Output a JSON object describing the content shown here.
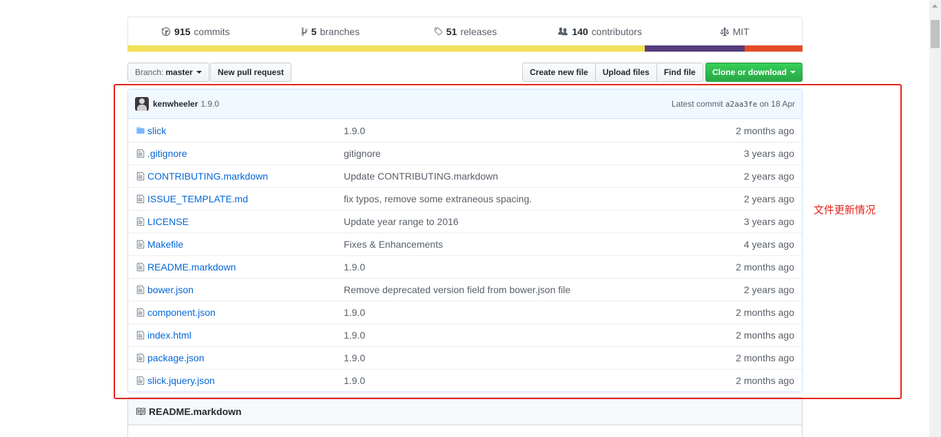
{
  "summary": {
    "commits_num": "915",
    "commits_label": "commits",
    "branches_num": "5",
    "branches_label": "branches",
    "releases_num": "51",
    "releases_label": "releases",
    "contributors_num": "140",
    "contributors_label": "contributors",
    "license": "MIT",
    "language_colors": [
      "#f1e05a",
      "#563d7c",
      "#e34c26"
    ],
    "language_shares": [
      0.766,
      0.148,
      0.086
    ]
  },
  "toolbar": {
    "branch_prefix": "Branch:",
    "branch_name": "master",
    "new_pull_request": "New pull request",
    "create_new_file": "Create new file",
    "upload_files": "Upload files",
    "find_file": "Find file",
    "clone_download": "Clone or download"
  },
  "commit": {
    "author": "kenwheeler",
    "message": "1.9.0",
    "latest_prefix": "Latest commit",
    "sha": "a2aa3fe",
    "date": "on 18 Apr"
  },
  "files": [
    {
      "type": "folder",
      "name": "slick",
      "message": "1.9.0",
      "age": "2 months ago"
    },
    {
      "type": "file",
      "name": ".gitignore",
      "message": "gitignore",
      "age": "3 years ago"
    },
    {
      "type": "file",
      "name": "CONTRIBUTING.markdown",
      "message": "Update CONTRIBUTING.markdown",
      "age": "2 years ago"
    },
    {
      "type": "file",
      "name": "ISSUE_TEMPLATE.md",
      "message": "fix typos, remove some extraneous spacing.",
      "age": "2 years ago"
    },
    {
      "type": "file",
      "name": "LICENSE",
      "message": "Update year range to 2016",
      "age": "3 years ago"
    },
    {
      "type": "file",
      "name": "Makefile",
      "message": "Fixes & Enhancements",
      "age": "4 years ago"
    },
    {
      "type": "file",
      "name": "README.markdown",
      "message": "1.9.0",
      "age": "2 months ago"
    },
    {
      "type": "file",
      "name": "bower.json",
      "message": "Remove deprecated version field from bower.json file",
      "age": "2 years ago"
    },
    {
      "type": "file",
      "name": "component.json",
      "message": "1.9.0",
      "age": "2 months ago"
    },
    {
      "type": "file",
      "name": "index.html",
      "message": "1.9.0",
      "age": "2 months ago"
    },
    {
      "type": "file",
      "name": "package.json",
      "message": "1.9.0",
      "age": "2 months ago"
    },
    {
      "type": "file",
      "name": "slick.jquery.json",
      "message": "1.9.0",
      "age": "2 months ago"
    }
  ],
  "readme": {
    "title": "README.markdown"
  },
  "annotation": {
    "text": "文件更新情况",
    "color": "#e2231a"
  }
}
